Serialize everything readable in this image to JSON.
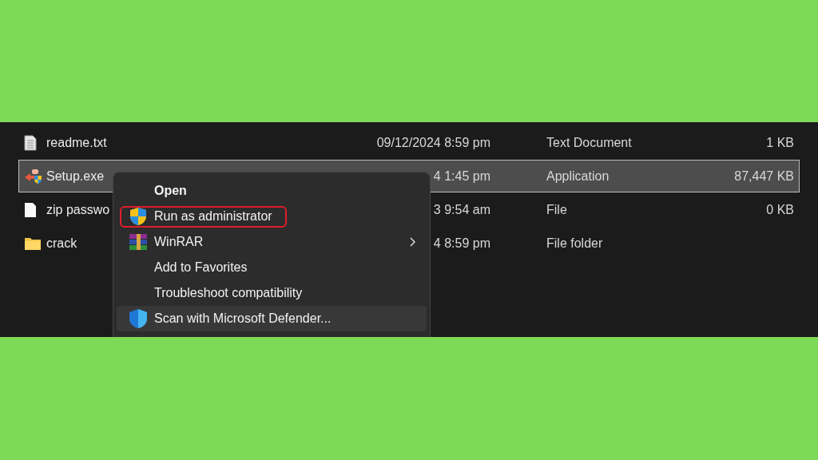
{
  "files": [
    {
      "kind": "text",
      "name": "readme.txt",
      "date": "09/12/2024 8:59 pm",
      "type": "Text Document",
      "size": "1 KB",
      "selected": false
    },
    {
      "kind": "setup",
      "name": "Setup.exe",
      "date": "4 1:45 pm",
      "type": "Application",
      "size": "87,447 KB",
      "selected": true
    },
    {
      "kind": "blank",
      "name": "zip passwo",
      "date": "3 9:54 am",
      "type": "File",
      "size": "0 KB",
      "selected": false
    },
    {
      "kind": "folder",
      "name": "crack",
      "date": "4 8:59 pm",
      "type": "File folder",
      "selected": false
    }
  ],
  "context_menu": {
    "items": [
      {
        "kind": "none",
        "label": "Open",
        "bold": true,
        "submenu": false,
        "hovered": false,
        "highlighted": false
      },
      {
        "kind": "uac-shield",
        "label": "Run as administrator",
        "bold": false,
        "submenu": false,
        "hovered": false,
        "highlighted": true
      },
      {
        "kind": "archive",
        "label": "WinRAR",
        "bold": false,
        "submenu": true,
        "hovered": false,
        "highlighted": false
      },
      {
        "kind": "none",
        "label": "Add to Favorites",
        "bold": false,
        "submenu": false,
        "hovered": false,
        "highlighted": false
      },
      {
        "kind": "none",
        "label": "Troubleshoot compatibility",
        "bold": false,
        "submenu": false,
        "hovered": false,
        "highlighted": false
      },
      {
        "kind": "defender",
        "label": "Scan with Microsoft Defender...",
        "bold": false,
        "submenu": false,
        "hovered": true,
        "highlighted": false
      }
    ]
  }
}
